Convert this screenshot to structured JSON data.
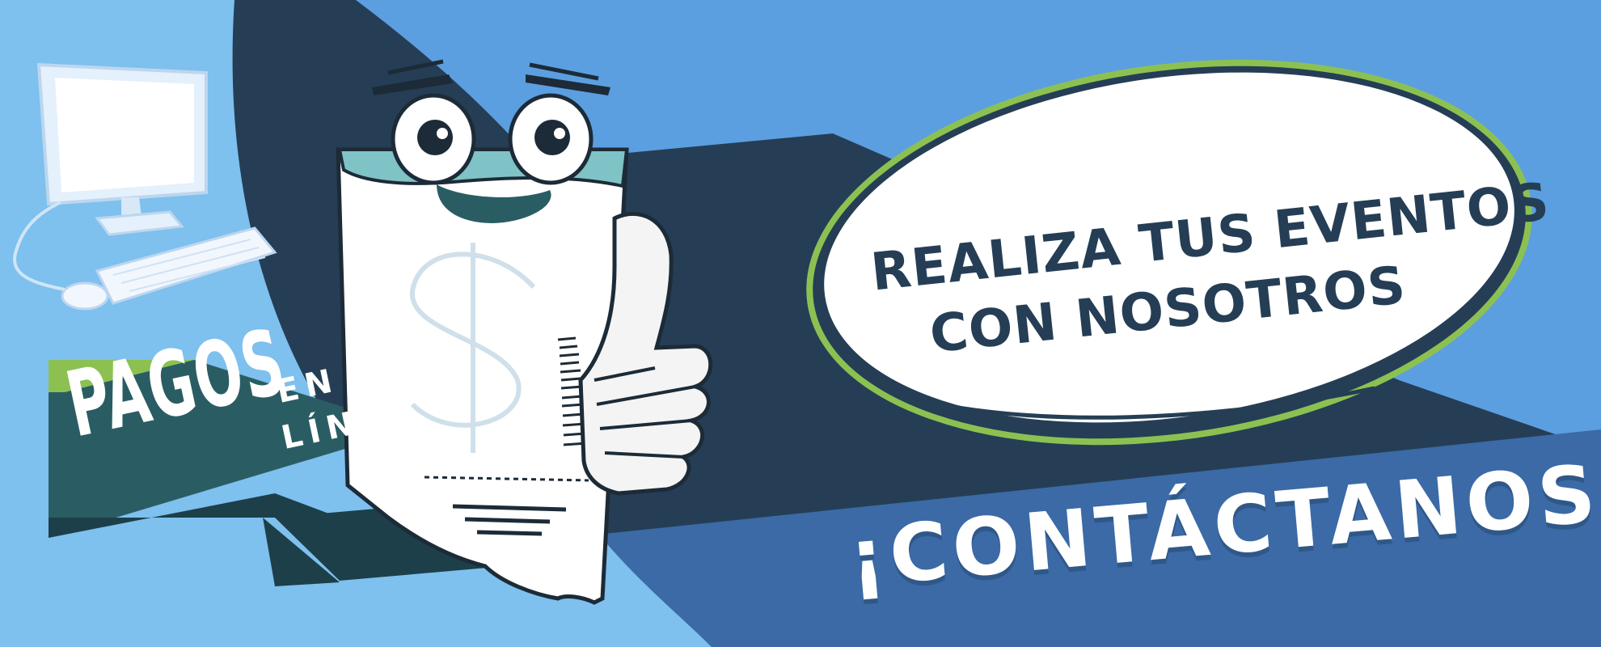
{
  "banner": {
    "pagos": "PAGOS",
    "en": "EN",
    "linea": "LÍNEA"
  },
  "bubble": {
    "line1": "REALIZA TUS EVENTOS",
    "line2": "CON NOSOTROS"
  },
  "cta": {
    "label": "¡CONTÁCTANOS!"
  },
  "colors": {
    "sky_blue": "#5b9fe0",
    "light_blue": "#7ec0ee",
    "navy": "#253e55",
    "teal": "#2a5d63",
    "accent_green": "#8cc152",
    "cta_blue": "#3b6aa6"
  },
  "icons": [
    "computer-monitor-icon",
    "keyboard-icon",
    "mouse-icon",
    "receipt-mascot-icon",
    "thumbs-up-icon",
    "barcode-icon",
    "dollar-sign-icon"
  ]
}
